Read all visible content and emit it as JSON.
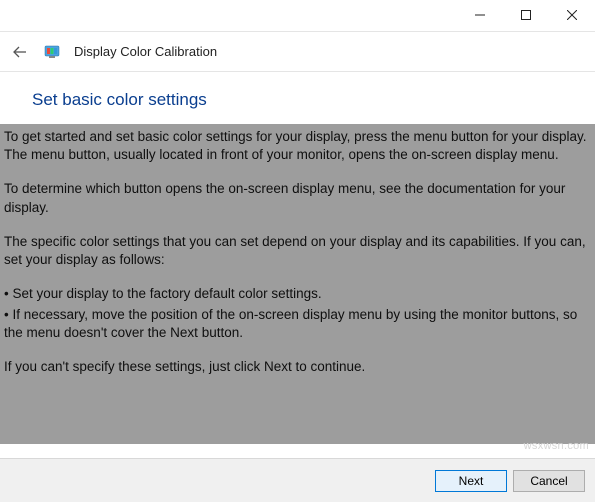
{
  "window": {
    "title": "Display Color Calibration"
  },
  "heading": "Set basic color settings",
  "body": {
    "p1": "To get started and set basic color settings for your display, press the menu button for your display. The menu button, usually located in front of your monitor, opens the on-screen display menu.",
    "p2": "To determine which button opens the on-screen display menu, see the documentation for your display.",
    "p3": "The specific color settings that you can set depend on your display and its capabilities. If you can, set your display as follows:",
    "b1": "• Set your display to the factory default color settings.",
    "b2": "• If necessary, move the position of the on-screen display menu by using the monitor buttons, so the menu doesn't cover the Next button.",
    "p4": "If you can't specify these settings,  just click Next to continue."
  },
  "buttons": {
    "next": "Next",
    "cancel": "Cancel"
  },
  "watermark": "wsxwsn.com"
}
